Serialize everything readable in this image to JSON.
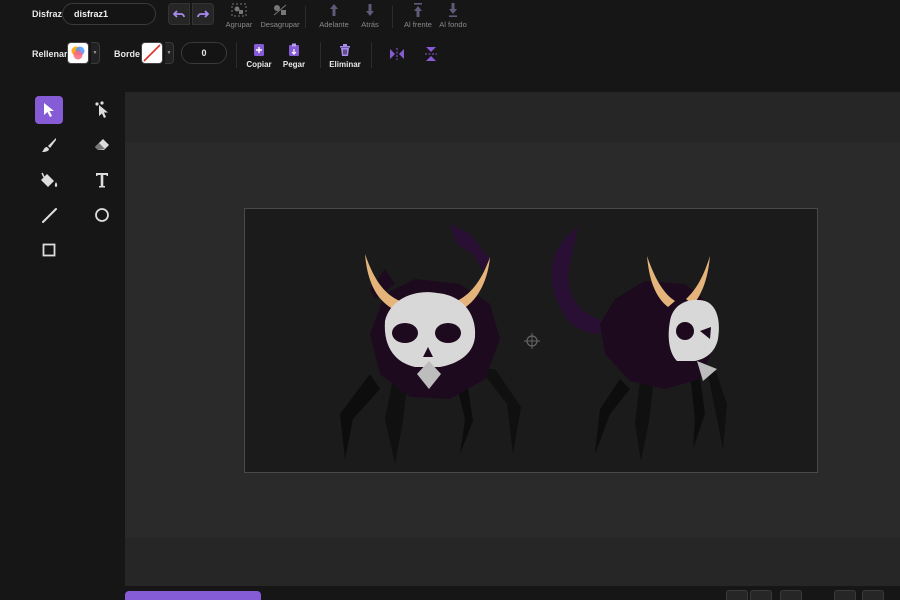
{
  "toolbar": {
    "costume_label": "Disfraz",
    "costume_name": "disfraz1",
    "group_label": "Agrupar",
    "ungroup_label": "Desagrupar",
    "forward_label": "Adelante",
    "backward_label": "Atrás",
    "front_label": "Al frente",
    "back_label": "Al fondo",
    "fill_label": "Rellenar",
    "outline_label": "Borde",
    "outline_width": "0",
    "copy_label": "Copiar",
    "paste_label": "Pegar",
    "delete_label": "Eliminar"
  },
  "tools": {
    "selected": "select",
    "items": [
      "select",
      "reshape",
      "brush",
      "eraser",
      "fill",
      "text",
      "line",
      "circle",
      "rectangle"
    ]
  },
  "colors": {
    "accent": "#855cd6",
    "background": "#161616",
    "canvas_bg": "#1b1b1b",
    "creature_body": "#1e0a1e",
    "horn": "#e5b47a",
    "skull": "#d8d8d8"
  }
}
